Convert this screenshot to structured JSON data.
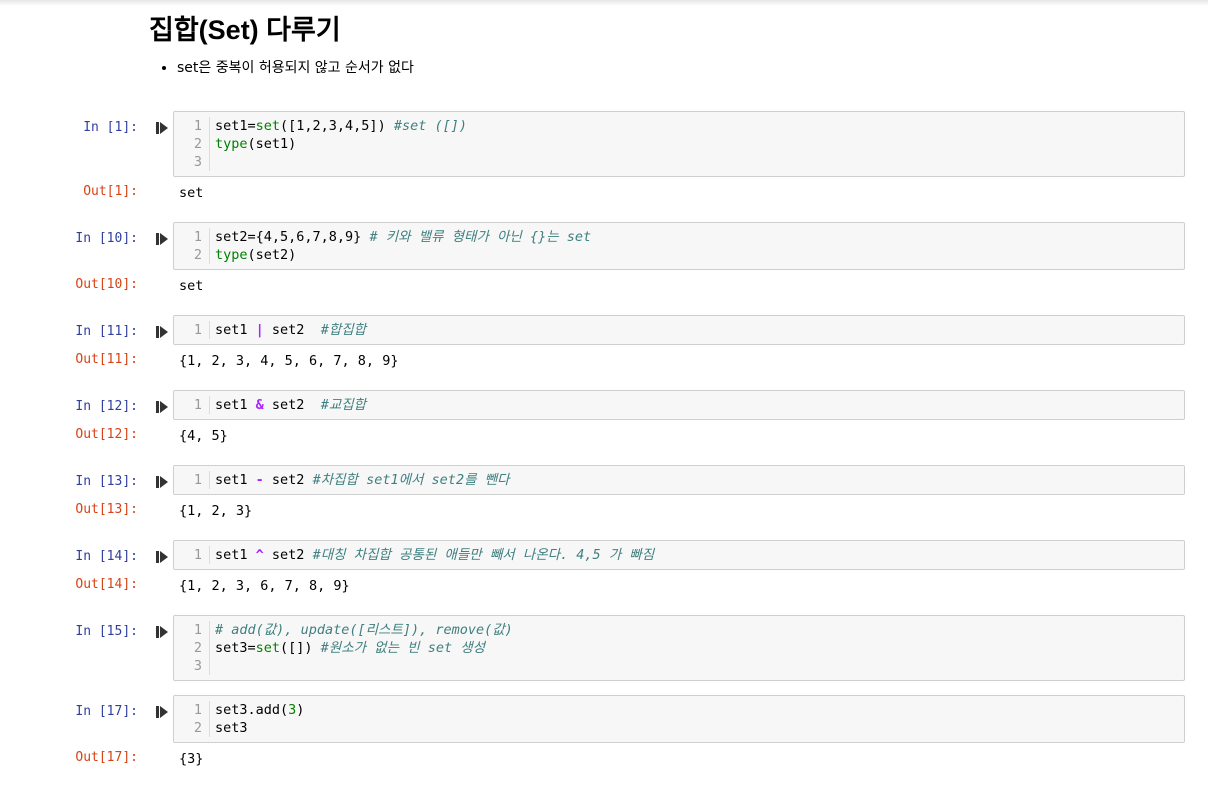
{
  "markdown": {
    "title": "집합(Set) 다루기",
    "bullet": "set은 중복이 허용되지 않고 순서가 없다"
  },
  "colors": {
    "in_prompt": "#303f9f",
    "out_prompt": "#d84315",
    "builtin": "#008000",
    "comment": "#408080",
    "operator": "#aa22ff"
  },
  "icons": {
    "run": "run-cell-icon"
  },
  "cells": [
    {
      "in_prompt": "In [1]:",
      "line_numbers": [
        "1",
        "2",
        "3"
      ],
      "lines": [
        {
          "a": "set1=",
          "b": "set",
          "c": "([1,2,3,4,5]) ",
          "d": "#set ([])"
        },
        {
          "a": "",
          "b": "type",
          "c": "(set1)",
          "d": ""
        },
        {
          "a": "",
          "b": "",
          "c": "",
          "d": ""
        }
      ],
      "out_prompt": "Out[1]:",
      "output": "set"
    },
    {
      "in_prompt": "In [10]:",
      "line_numbers": [
        "1",
        "2"
      ],
      "lines": [
        {
          "a": "set2={4,5,6,7,8,9} ",
          "b": "",
          "c": "",
          "d": "# 키와 밸류 형태가 아닌 {}는 set"
        },
        {
          "a": "",
          "b": "type",
          "c": "(set2)",
          "d": ""
        }
      ],
      "out_prompt": "Out[10]:",
      "output": "set"
    },
    {
      "in_prompt": "In [11]:",
      "line_numbers": [
        "1"
      ],
      "lines": [
        {
          "a": "set1 ",
          "op": "|",
          "c": " set2  ",
          "d": "#합집합"
        }
      ],
      "out_prompt": "Out[11]:",
      "output": "{1, 2, 3, 4, 5, 6, 7, 8, 9}"
    },
    {
      "in_prompt": "In [12]:",
      "line_numbers": [
        "1"
      ],
      "lines": [
        {
          "a": "set1 ",
          "op": "&",
          "c": " set2  ",
          "d": "#교집합"
        }
      ],
      "out_prompt": "Out[12]:",
      "output": "{4, 5}"
    },
    {
      "in_prompt": "In [13]:",
      "line_numbers": [
        "1"
      ],
      "lines": [
        {
          "a": "set1 ",
          "op": "-",
          "c": " set2 ",
          "d": "#차집합 set1에서 set2를 뺀다"
        }
      ],
      "out_prompt": "Out[13]:",
      "output": "{1, 2, 3}"
    },
    {
      "in_prompt": "In [14]:",
      "line_numbers": [
        "1"
      ],
      "lines": [
        {
          "a": "set1 ",
          "op": "^",
          "c": " set2 ",
          "d": "#대칭 차집합 공통된 애들만 빼서 나온다. 4,5 가 빠짐"
        }
      ],
      "out_prompt": "Out[14]:",
      "output": "{1, 2, 3, 6, 7, 8, 9}"
    },
    {
      "in_prompt": "In [15]:",
      "line_numbers": [
        "1",
        "2",
        "3"
      ],
      "lines": [
        {
          "a": "",
          "b": "",
          "c": "",
          "d": "# add(값), update([리스트]), remove(값)"
        },
        {
          "a": "set3=",
          "b": "set",
          "c": "([]) ",
          "d": "#원소가 없는 빈 set 생성"
        },
        {
          "a": "",
          "b": "",
          "c": "",
          "d": ""
        }
      ],
      "out_prompt": "",
      "output": ""
    },
    {
      "in_prompt": "In [17]:",
      "line_numbers": [
        "1",
        "2"
      ],
      "lines": [
        {
          "a": "set3.add(",
          "b": "3",
          "c": ")",
          "d": ""
        },
        {
          "a": "set3",
          "b": "",
          "c": "",
          "d": ""
        }
      ],
      "out_prompt": "Out[17]:",
      "output": "{3}"
    }
  ]
}
